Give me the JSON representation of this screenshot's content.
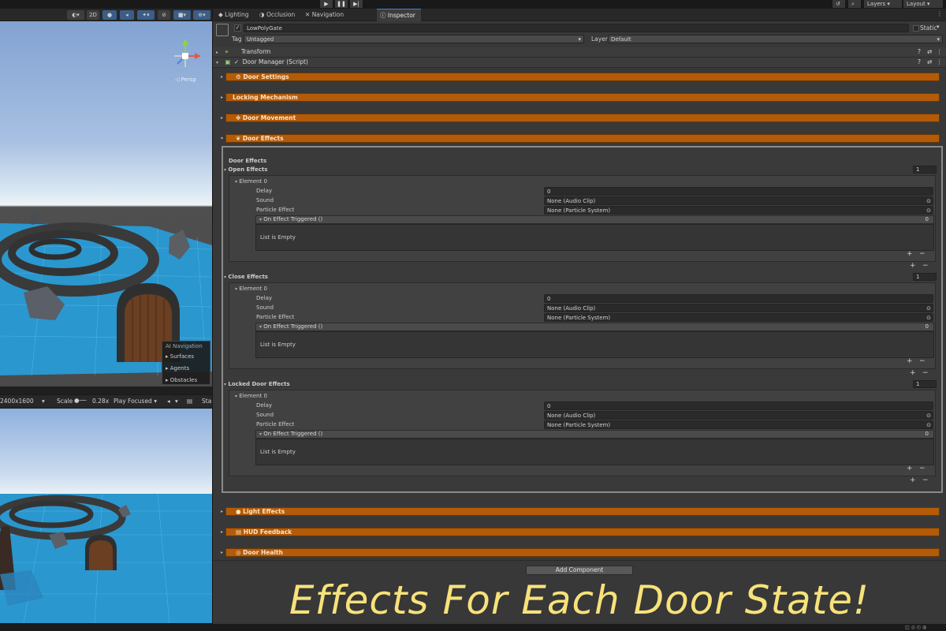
{
  "toolbar": {
    "play_icon": "play-icon",
    "pause_icon": "pause-icon",
    "step_icon": "step-icon",
    "layers_label": "Layers",
    "layout_label": "Layout"
  },
  "scene": {
    "toggle_2d": "2D",
    "persp_label": "◁ Persp",
    "ai_navigation": {
      "title": "AI Navigation",
      "items": [
        "Surfaces",
        "Agents",
        "Obstacles"
      ]
    }
  },
  "game": {
    "resolution": "2400x1600",
    "scale_label": "Scale",
    "scale_value": "0.28x",
    "play_mode": "Play Focused",
    "stats_label": "Sta"
  },
  "tabs": [
    "Lighting",
    "Occlusion",
    "Navigation (Obsolete)",
    "Inspector"
  ],
  "inspector": {
    "object_name": "LowPolyGate",
    "static_label": "Static",
    "tag_label": "Tag",
    "tag_value": "Untagged",
    "layer_label": "Layer",
    "layer_value": "Default",
    "transform_label": "Transform",
    "script_label": "Door Manager (Script)",
    "sections_top": [
      "Door Settings",
      "Locking Mechanism",
      "Door Movement",
      "Door Effects"
    ],
    "door_effects_header": "Door Effects",
    "effect_groups": [
      {
        "title": "Open Effects",
        "count": "1"
      },
      {
        "title": "Close Effects",
        "count": "1"
      },
      {
        "title": "Locked Door Effects",
        "count": "1"
      }
    ],
    "element_label": "Element 0",
    "fields": {
      "delay_label": "Delay",
      "delay_value": "0",
      "sound_label": "Sound",
      "sound_value": "None (Audio Clip)",
      "particle_label": "Particle Effect",
      "particle_value": "None (Particle System)"
    },
    "event_label": "On Effect Triggered ()",
    "event_count": "0",
    "list_empty": "List is Empty",
    "plus": "+",
    "minus": "−",
    "sections_bottom": [
      "Light Effects",
      "HUD Feedback",
      "Door Health"
    ],
    "add_component": "Add Component"
  },
  "banner": "Effects For Each Door State!"
}
